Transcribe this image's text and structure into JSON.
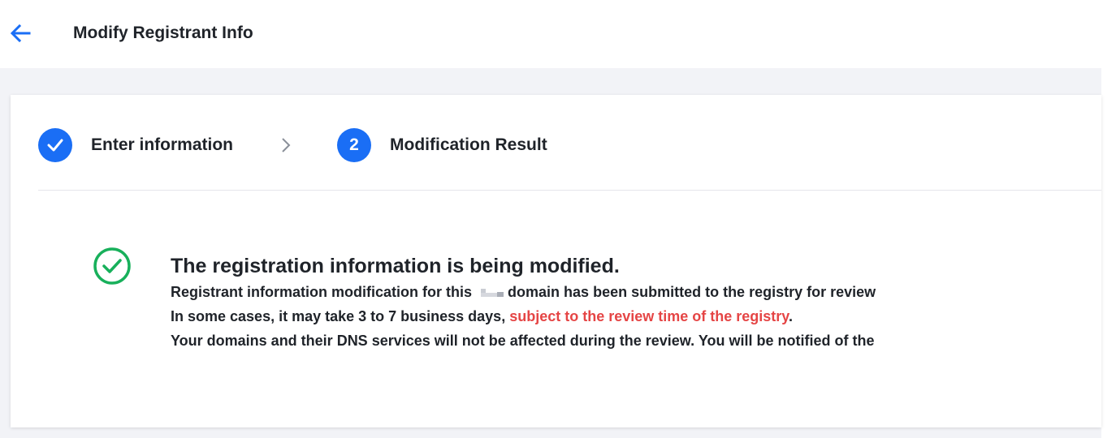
{
  "header": {
    "title": "Modify Registrant Info",
    "back_icon": "arrow-left-icon"
  },
  "steps": [
    {
      "number": "1",
      "label": "Enter information",
      "state": "completed",
      "icon": "check-icon"
    },
    {
      "number": "2",
      "label": "Modification Result",
      "state": "active"
    }
  ],
  "step_separator_icon": "chevron-right-icon",
  "result": {
    "icon": "success-check-circle-icon",
    "title": "The registration information is being modified.",
    "line1_before": "Registrant information modification for this",
    "line1_after": "domain has been submitted to the registry for review",
    "line2_before": "In some cases, it may take 3 to 7 business days, ",
    "line2_highlight": "subject to the review time of the registry",
    "line2_after": ".",
    "line3": "Your domains and their DNS services will not be affected during the review. You will be notified of the"
  },
  "colors": {
    "primary": "#1a6ef5",
    "success": "#18b05b",
    "highlight": "#e54545",
    "text": "#1f2329",
    "background": "#f2f3f7"
  }
}
